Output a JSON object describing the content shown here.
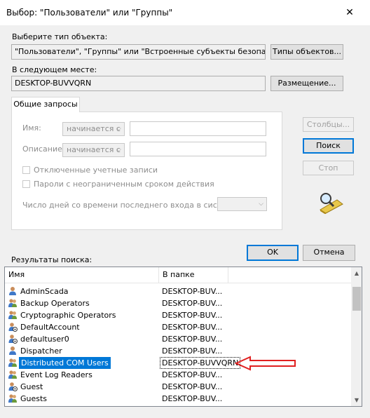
{
  "window": {
    "title": "Выбор: \"Пользователи\" или \"Группы\"",
    "close_label": "✕"
  },
  "object_type": {
    "label": "Выберите тип объекта:",
    "value": "\"Пользователи\", \"Группы\" или \"Встроенные субъекты безопасности\"",
    "button": "Типы объектов..."
  },
  "location": {
    "label": "В следующем месте:",
    "value": "DESKTOP-BUVVQRN",
    "button": "Размещение..."
  },
  "common_queries": {
    "tab_label": "Общие запросы",
    "name_label": "Имя:",
    "name_mode": "начинается с",
    "description_label": "Описание:",
    "description_mode": "начинается с",
    "disabled_accounts_label": "Отключенные учетные записи",
    "non_expiring_passwords_label": "Пароли с неограниченным сроком действия",
    "days_since_logon_label": "Число дней со времени последнего входа в систему:",
    "days_since_logon_value": ""
  },
  "side_buttons": {
    "columns": "Столбцы...",
    "search": "Поиск",
    "stop": "Стоп"
  },
  "dialog_buttons": {
    "ok": "OK",
    "cancel": "Отмена"
  },
  "results": {
    "label": "Результаты поиска:",
    "columns": [
      "Имя",
      "В папке"
    ],
    "rows": [
      {
        "name": "AdminScada",
        "folder": "DESKTOP-BUV...",
        "icon": "user-icon"
      },
      {
        "name": "Backup Operators",
        "folder": "DESKTOP-BUV...",
        "icon": "group-icon"
      },
      {
        "name": "Cryptographic Operators",
        "folder": "DESKTOP-BUV...",
        "icon": "group-icon"
      },
      {
        "name": "DefaultAccount",
        "folder": "DESKTOP-BUV...",
        "icon": "disabled-user-icon"
      },
      {
        "name": "defaultuser0",
        "folder": "DESKTOP-BUV...",
        "icon": "disabled-user-icon"
      },
      {
        "name": "Dispatcher",
        "folder": "DESKTOP-BUV...",
        "icon": "user-icon"
      },
      {
        "name": "Distributed COM Users",
        "folder": "DESKTOP-BUVVQRN",
        "icon": "group-icon",
        "selected": true
      },
      {
        "name": "Event Log Readers",
        "folder": "DESKTOP-BUV...",
        "icon": "group-icon"
      },
      {
        "name": "Guest",
        "folder": "DESKTOP-BUV...",
        "icon": "disabled-user-icon"
      },
      {
        "name": "Guests",
        "folder": "DESKTOP-BUV...",
        "icon": "group-icon"
      }
    ]
  },
  "colors": {
    "selection": "#0078d7",
    "annotation_arrow": "#e02020",
    "dialog_background": "#f0f0f0"
  }
}
